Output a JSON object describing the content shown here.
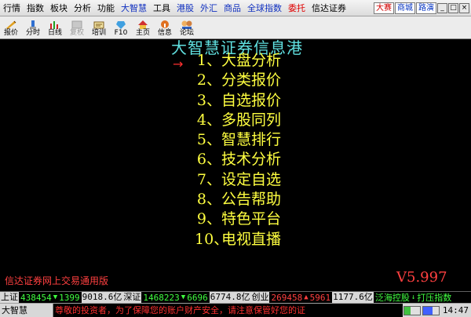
{
  "menubar": {
    "items": [
      {
        "label": "行情",
        "color": "default"
      },
      {
        "label": "指数",
        "color": "default"
      },
      {
        "label": "板块",
        "color": "default"
      },
      {
        "label": "分析",
        "color": "default"
      },
      {
        "label": "功能",
        "color": "default"
      },
      {
        "label": "大智慧",
        "color": "blue"
      },
      {
        "label": "工具",
        "color": "default"
      },
      {
        "label": "港股",
        "color": "blue"
      },
      {
        "label": "外汇",
        "color": "blue"
      },
      {
        "label": "商品",
        "color": "blue"
      },
      {
        "label": "全球指数",
        "color": "blue"
      },
      {
        "label": "委托",
        "color": "red"
      },
      {
        "label": "信达证券",
        "color": "default"
      }
    ],
    "right_buttons": [
      {
        "label": "大赛",
        "color": "red"
      },
      {
        "label": "商城",
        "color": "blue"
      },
      {
        "label": "路演",
        "color": "blue"
      }
    ],
    "window_buttons": [
      "_",
      "□",
      "×"
    ]
  },
  "toolbar": {
    "items": [
      {
        "label": "报价",
        "icon": "quote-icon"
      },
      {
        "label": "分时",
        "icon": "timeline-icon"
      },
      {
        "label": "日线",
        "icon": "daily-chart-icon"
      },
      {
        "label": "复权",
        "icon": "restore-right-icon",
        "disabled": true
      },
      {
        "label": "培训",
        "icon": "training-icon"
      },
      {
        "label": "F10",
        "icon": "f10-icon"
      },
      {
        "label": "主页",
        "icon": "home-icon"
      },
      {
        "label": "信息",
        "icon": "info-icon"
      },
      {
        "label": "论坛",
        "icon": "forum-icon"
      }
    ]
  },
  "main": {
    "title": "大智慧证券信息港",
    "arrow": "→",
    "menu": [
      {
        "num": "1、",
        "label": "大盘分析"
      },
      {
        "num": "2、",
        "label": "分类报价"
      },
      {
        "num": "3、",
        "label": "自选报价"
      },
      {
        "num": "4、",
        "label": "多股同列"
      },
      {
        "num": "5、",
        "label": "智慧排行"
      },
      {
        "num": "6、",
        "label": "技术分析"
      },
      {
        "num": "7、",
        "label": "设定自选"
      },
      {
        "num": "8、",
        "label": "公告帮助"
      },
      {
        "num": "9、",
        "label": "特色平台"
      },
      {
        "num": "10、",
        "label": "电视直播"
      }
    ],
    "footer_left": "信达证券网上交易通用版",
    "version": "V5.997"
  },
  "ticker": {
    "sh_label": "上证",
    "sh_value": "438454",
    "sh_change": "1399",
    "sh_amount": "9018.6亿",
    "sz_label": "深证",
    "sz_value": "1468223",
    "sz_change": "6696",
    "sz_amount": "6774.8亿",
    "cy_label": "创业",
    "cy_value": "269458",
    "cy_change": "5961",
    "cy_amount": "1177.6亿",
    "stock_label": "泛海控股",
    "stock_text": "打压指数"
  },
  "statusbar": {
    "app_name": "大智慧",
    "notice": "尊敬的投资者，为了保障您的账户财产安全，请注意保管好您的证",
    "time": "14:47"
  }
}
